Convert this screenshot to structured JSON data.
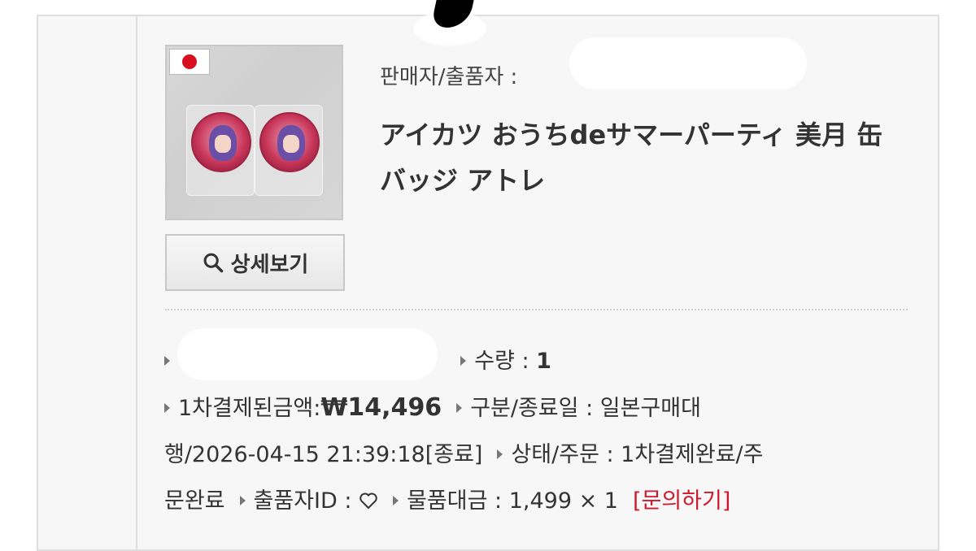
{
  "seller": {
    "label": "판매자/출품자 : ",
    "value_hidden": true
  },
  "product": {
    "title": "アイカツ おうちdeサマーパーティ 美月 缶バッジ アトレ",
    "flag_icon": "japan-flag-icon"
  },
  "actions": {
    "detail_label": "상세보기",
    "detail_icon": "search-icon"
  },
  "info": {
    "quantity_label": "수량 : ",
    "quantity_value": "1",
    "first_paid_label": "1차결제된금액:",
    "first_paid_value": "₩14,496",
    "type_end_label": "구분/종료일 : ",
    "type_end_value": "일본구매대행/2026-04-15 21:39:18[종료]",
    "status_label": "상태/주문 : ",
    "status_value": "1차결제완료/주문완료",
    "exhibitor_label": "출품자ID : ",
    "exhibitor_icon": "heart-icon",
    "goods_price_label": "물품대금 : ",
    "goods_price_value": "1,499 × 1",
    "inquiry_label": "[문의하기]"
  },
  "colors": {
    "inquiry": "#d0182c",
    "flag_red": "#d80f1f"
  }
}
